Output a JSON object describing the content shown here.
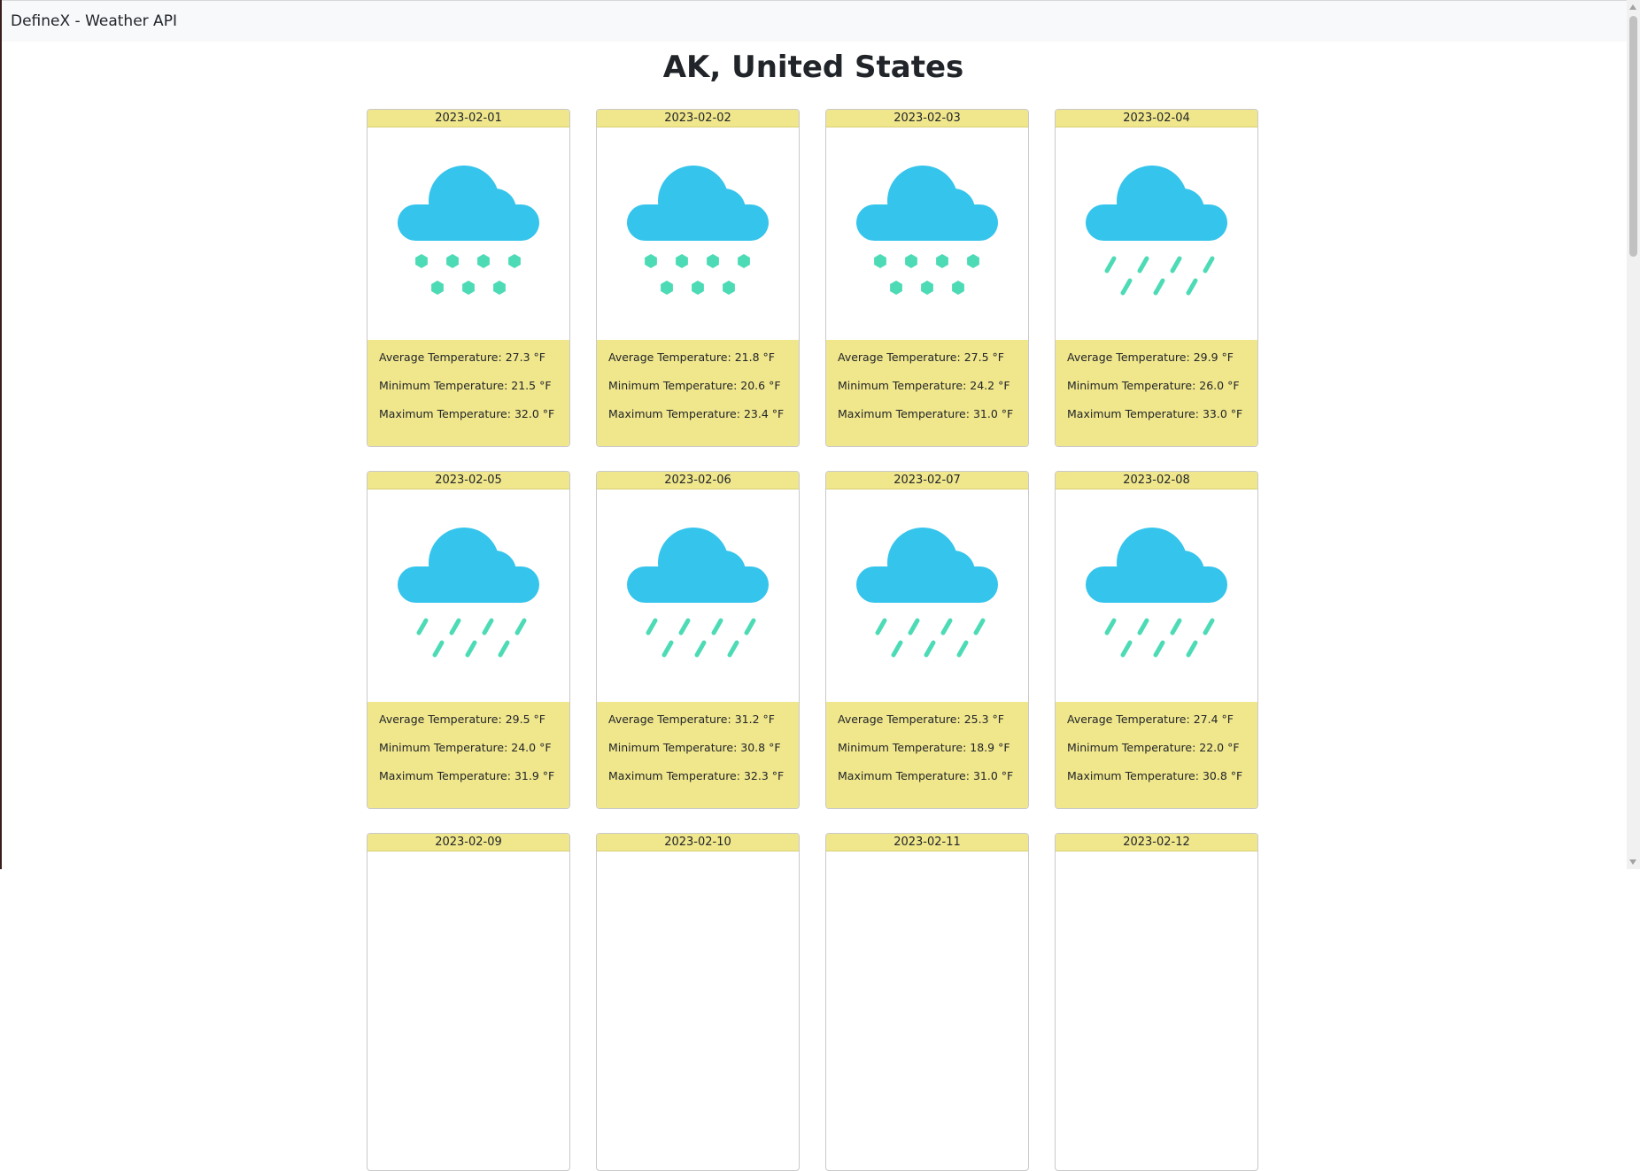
{
  "navbar": {
    "brand": "DefineX - Weather API"
  },
  "page_title": "AK, United States",
  "labels": {
    "avg": "Average Temperature:",
    "min": "Minimum Temperature:",
    "max": "Maximum Temperature:",
    "unit": "°F"
  },
  "colors": {
    "cloud": "#35c4ec",
    "precip": "#4ddbb6",
    "card_accent": "#f0e68c"
  },
  "cards": [
    {
      "date": "2023-02-01",
      "icon": "snow-cloud-icon",
      "avg": "27.3",
      "min": "21.5",
      "max": "32.0"
    },
    {
      "date": "2023-02-02",
      "icon": "snow-cloud-icon",
      "avg": "21.8",
      "min": "20.6",
      "max": "23.4"
    },
    {
      "date": "2023-02-03",
      "icon": "snow-cloud-icon",
      "avg": "27.5",
      "min": "24.2",
      "max": "31.0"
    },
    {
      "date": "2023-02-04",
      "icon": "rain-cloud-icon",
      "avg": "29.9",
      "min": "26.0",
      "max": "33.0"
    },
    {
      "date": "2023-02-05",
      "icon": "rain-cloud-icon",
      "avg": "29.5",
      "min": "24.0",
      "max": "31.9"
    },
    {
      "date": "2023-02-06",
      "icon": "rain-cloud-icon",
      "avg": "31.2",
      "min": "30.8",
      "max": "32.3"
    },
    {
      "date": "2023-02-07",
      "icon": "rain-cloud-icon",
      "avg": "25.3",
      "min": "18.9",
      "max": "31.0"
    },
    {
      "date": "2023-02-08",
      "icon": "rain-cloud-icon",
      "avg": "27.4",
      "min": "22.0",
      "max": "30.8"
    },
    {
      "date": "2023-02-09"
    },
    {
      "date": "2023-02-10"
    },
    {
      "date": "2023-02-11"
    },
    {
      "date": "2023-02-12"
    }
  ]
}
